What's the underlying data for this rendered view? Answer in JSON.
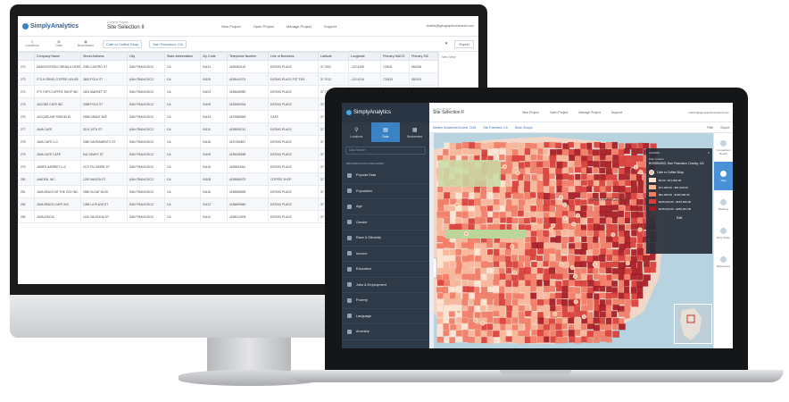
{
  "desktop": {
    "app_name": "SimplyAnalytics",
    "project_label": "Current Project",
    "project_name": "Site Selection II",
    "menu": [
      "New Project",
      "Open Project",
      "Manage Project",
      "Support"
    ],
    "user_email": "charles@geographicresearch.com",
    "tool_items": [
      "Locations",
      "Data",
      "Businesses"
    ],
    "filter_business": "Cafe or Coffee Shop",
    "filter_location": "San Francisco, CA",
    "view_menu": "▾",
    "export_label": "Export",
    "new_view_label": "New View",
    "table_headers": [
      "",
      "Company Name",
      "Street Address",
      "City",
      "State Abbreviation",
      "Zip Code",
      "Telephone Number",
      "Line of Business",
      "Latitude",
      "Longitude",
      "Primary NAICS",
      "Primary SIC"
    ],
    "table_rows": [
      [
        "272",
        "MANGOSTEEN CREAM & DESSERTS",
        "2390 CASTRO ST",
        "SAN FRANCISCO",
        "CA",
        "94131",
        "4155482115",
        "EATING PLACE",
        "37.7502",
        "-122.4339",
        "722511",
        "581208"
      ],
      [
        "273",
        "IT'S A GRIND COFFEE HOUSE",
        "3600 POLK ST",
        "SAN FRANCISCO",
        "CA",
        "94109",
        "4155442274",
        "EATING PLACE FST FDS",
        "37.7912",
        "-122.4215",
        "722513",
        "581203"
      ],
      [
        "274",
        "IT'S TOPS COFFEE SHOP INC",
        "1801 MARKET ST",
        "SAN FRANCISCO",
        "CA",
        "94103",
        "4155636950",
        "EATING PLACE",
        "37.7711",
        "-122.4245",
        "722511",
        "581208"
      ],
      [
        "275",
        "JACOBS CAFE INC",
        "3098 POLK ST",
        "SAN FRANCISCO",
        "CA",
        "94109",
        "4152659334",
        "EATING PLACE",
        "37.8014",
        "-122.4212",
        "722511",
        "581208"
      ],
      [
        "276",
        "JACQUELINE PARGELIS",
        "3008 GRANT AVE",
        "SAN FRANCISCO",
        "CA",
        "94133",
        "4157885563",
        "CAFE",
        "37.7990",
        "-122.4075",
        "722515",
        "581228"
      ],
      [
        "277",
        "JAVA CAFE",
        "3101 20TH ST",
        "SAN FRANCISCO",
        "CA",
        "94110",
        "4155508741",
        "EATING PLACE",
        "37.7588",
        "-122.4117",
        "722511",
        "581208"
      ],
      [
        "278",
        "JAVA CAFE LLC",
        "3380 SACRAMENTO ST",
        "SAN FRANCISCO",
        "CA",
        "94118",
        "4157496547",
        "EATING PLACE",
        "37.7880",
        "-122.4476",
        "722511",
        "581208"
      ],
      [
        "279",
        "JAVA GATE CAFE",
        "842 GEARY ST",
        "SAN FRANCISCO",
        "CA",
        "94109",
        "4155435055",
        "EATING PLACE",
        "37.7862",
        "-122.4173",
        "722511",
        "581208"
      ],
      [
        "279",
        "JAMES HARRIET LLC",
        "2127 FILLMORE ST",
        "SAN FRANCISCO",
        "CA",
        "94115",
        "4155633441",
        "EATING PLACE",
        "37.7890",
        "-122.4339",
        "722511",
        "581208"
      ],
      [
        "280",
        "JANDEN, INC",
        "1290 MASON ST",
        "SAN FRANCISCO",
        "CA",
        "94108",
        "4155686075",
        "COFFEE SHOP",
        "37.7940",
        "-122.4117",
        "722515",
        "581228"
      ],
      [
        "281",
        "JAVA BEACH AT THE ZOO INC",
        "2650 SLOAT BLVD",
        "SAN FRANCISCO",
        "CA",
        "94116",
        "4156658595",
        "EATING PLACE",
        "37.7351",
        "-122.5015",
        "722511",
        "581208"
      ],
      [
        "282",
        "JAVA BEACH CAFE INC",
        "1396 LA PLAYA ST",
        "SAN FRANCISCO",
        "CA",
        "94122",
        "4156659560",
        "EATING PLACE",
        "37.7593",
        "-122.5094",
        "722511",
        "581208"
      ],
      [
        "283",
        "JAVALENCIA",
        "1100 VALENCIA ST",
        "SAN FRANCISCO",
        "CA",
        "94110",
        "4158212005",
        "EATING PLACE",
        "37.7557",
        "-122.4210",
        "722511",
        "581208"
      ]
    ]
  },
  "laptop": {
    "app_name": "SimplyAnalytics",
    "project_label": "Current Project",
    "project_name": "Site Selection II",
    "menu": [
      "New Project",
      "Open Project",
      "Manage Project",
      "Support"
    ],
    "user_email": "charles@geographicresearch.com",
    "sidebar_tabs": [
      "Locations",
      "Data",
      "Businesses"
    ],
    "search_placeholder": "Data Search",
    "browse_heading": "Browse Data Categories",
    "categories": [
      "Popular Data",
      "Population",
      "Age",
      "Gender",
      "Race & Ethnicity",
      "Income",
      "Education",
      "Jobs & Employment",
      "Poverty",
      "Language",
      "Ancestry"
    ],
    "toolbar_variable": "Median Household Income, 2016",
    "toolbar_location": "San Francisco, CA",
    "toolbar_level": "Block Groups",
    "toolbar_right": [
      "Filter",
      "Export"
    ],
    "legend_title": "LEGEND",
    "legend_location_label": "Map location",
    "legend_location": "BG0554003, San Francisco County, CA",
    "legend_poi": "Cafe or Coffee Shop",
    "legend_bins": [
      {
        "label": "$0.00 - $71,000.00",
        "color": "#fde4d2"
      },
      {
        "label": "$71,000.00 - $91,000.00",
        "color": "#f9b59a"
      },
      {
        "label": "$91,000.00 - $106,000.00",
        "color": "#f17c66"
      },
      {
        "label": "$106,000.00 - $135,000.00",
        "color": "#d93d3a"
      },
      {
        "label": "$135,000.00 - $250,001.00",
        "color": "#a51a22"
      }
    ],
    "legend_edit": "Edit",
    "map_label": "SAN FRANCISCO",
    "right_rail": [
      "Comparison Report",
      "Map",
      "Ranking",
      "Ring Study",
      "Businesses"
    ]
  }
}
